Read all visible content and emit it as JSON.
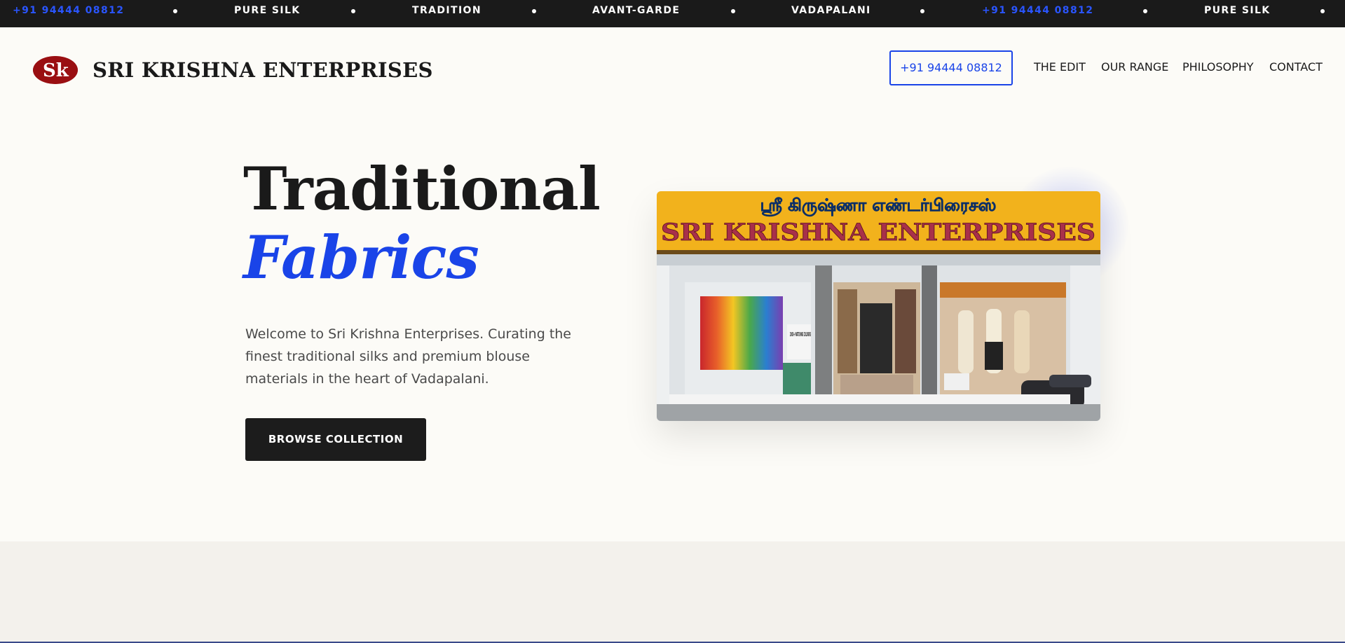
{
  "ticker": {
    "items": [
      {
        "text": "+91 94444 08812",
        "type": "phone"
      },
      {
        "text": "PURE SILK",
        "type": "text"
      },
      {
        "text": "TRADITION",
        "type": "text"
      },
      {
        "text": "AVANT-GARDE",
        "type": "text"
      },
      {
        "text": "VADAPALANI",
        "type": "text"
      },
      {
        "text": "+91 94444 08812",
        "type": "phone"
      },
      {
        "text": "PURE SILK",
        "type": "text"
      }
    ]
  },
  "header": {
    "logo_text": "Sk",
    "brand": "SRI KRISHNA ENTERPRISES",
    "phone_button": "+91 94444 08812",
    "nav": [
      "THE EDIT",
      "OUR RANGE",
      "PHILOSOPHY",
      "CONTACT"
    ]
  },
  "hero": {
    "title_line1": "Traditional",
    "title_line2": "Fabrics",
    "description": "Welcome to Sri Krishna Enterprises. Curating the finest traditional silks and premium blouse materials in the heart of Vadapalani.",
    "cta": "BROWSE COLLECTION"
  },
  "store_image": {
    "sign_tamil": "ஸ்ரீ கிருஷ்ணா எண்டர்பிரைசஸ்",
    "sign_english": "SRI KRISHNA ENTERPRISES",
    "window_label": "2000+ MATCHING COLOURS"
  },
  "colors": {
    "accent": "#1a44e8",
    "dark": "#1a1a1a",
    "background": "#fcfbf7",
    "logo_red": "#9a0f12"
  }
}
